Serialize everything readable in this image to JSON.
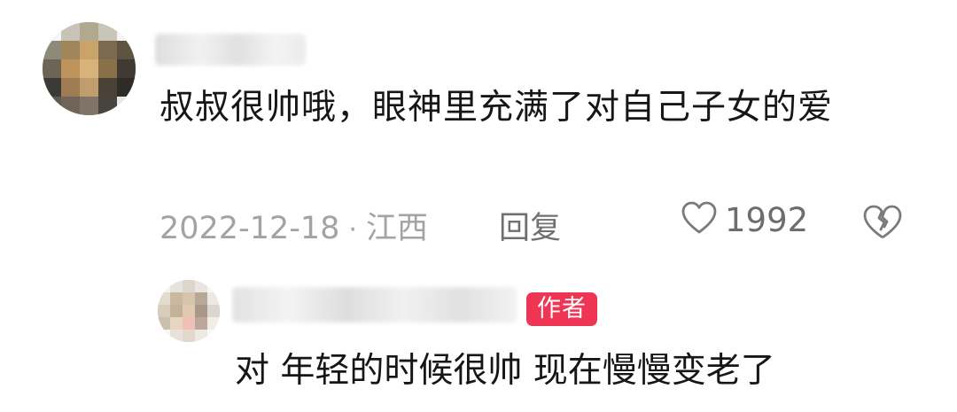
{
  "comment": {
    "text": "叔叔很帅哦，眼神里充满了对自己子女的爱",
    "date": "2022-12-18",
    "separator": "·",
    "location": "江西",
    "reply_label": "回复",
    "like_count": "1992",
    "like_icon": "heart-outline-icon",
    "dislike_icon": "broken-heart-icon"
  },
  "reply": {
    "badge": "作者",
    "text": "对 年轻的时候很帅 现在慢慢变老了",
    "badge_color": "#ee3554"
  },
  "colors": {
    "text_primary": "#161616",
    "text_meta": "#a3a3a3",
    "text_action": "#707070"
  }
}
